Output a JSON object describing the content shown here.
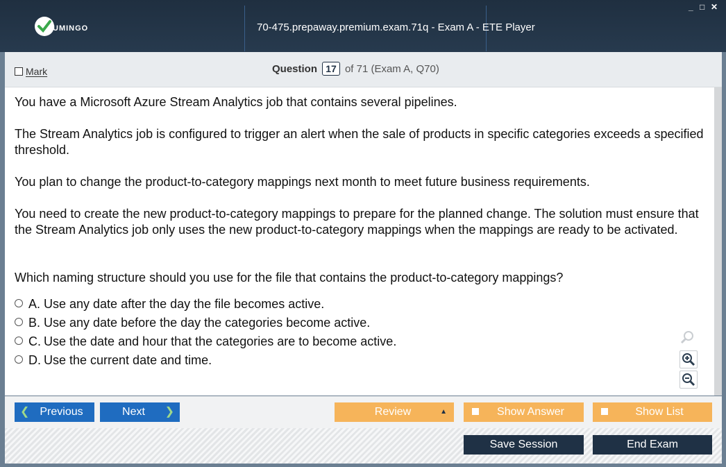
{
  "window": {
    "title": "70-475.prepaway.premium.exam.71q - Exam A - ETE Player",
    "logo_text": "UMINGO",
    "controls": [
      "_",
      "□",
      "✕"
    ]
  },
  "header": {
    "mark_label": "Mark",
    "question_label": "Question",
    "question_number": "17",
    "question_suffix": "of 71 (Exam A, Q70)"
  },
  "question": {
    "paragraphs": [
      "You have a Microsoft Azure Stream Analytics job that contains several pipelines.",
      "The Stream Analytics job is configured to trigger an alert when the sale of products in specific categories exceeds a specified threshold.",
      "You plan to change the product-to-category mappings next month to meet future business requirements.",
      "You need to create the new product-to-category mappings to prepare for the planned change. The solution must ensure that the Stream Analytics job only uses the new product-to-category mappings when the mappings are ready to be activated.",
      "Which naming structure should you use for the file that contains the product-to-category mappings?"
    ],
    "options": [
      {
        "letter": "A.",
        "text": "Use any date after the day the file becomes active."
      },
      {
        "letter": "B.",
        "text": "Use any date before the day the categories become active."
      },
      {
        "letter": "C.",
        "text": "Use the date and hour that the categories are to become active."
      },
      {
        "letter": "D.",
        "text": "Use the current date and time."
      }
    ]
  },
  "toolbar": {
    "previous_label": "Previous",
    "next_label": "Next",
    "review_label": "Review",
    "show_answer_label": "Show Answer",
    "show_list_label": "Show List",
    "save_session_label": "Save Session",
    "end_exam_label": "End Exam"
  },
  "zoom_icons": [
    "search-icon",
    "zoom-in-icon",
    "zoom-out-icon"
  ],
  "colors": {
    "titlebar": "#1f2f40",
    "nav_button": "#1f6cc0",
    "toggle_button": "#f6b45a",
    "action_button": "#1f3145"
  }
}
